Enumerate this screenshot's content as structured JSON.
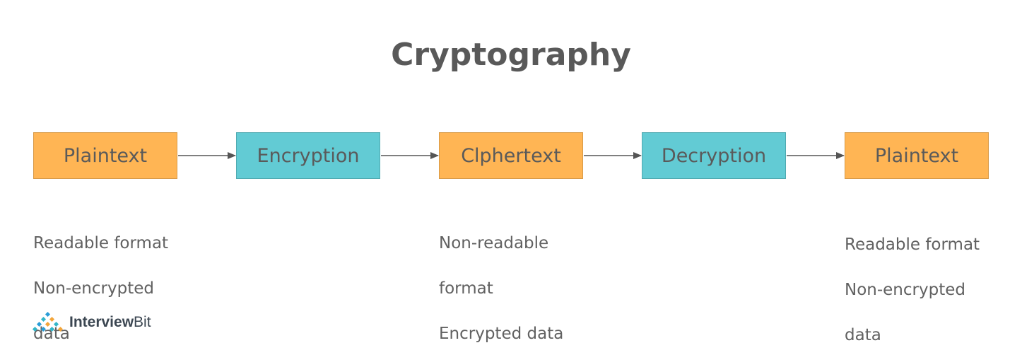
{
  "title": "Cryptography",
  "steps": [
    {
      "label": "Plaintext",
      "kind": "data",
      "color": "#ffb554"
    },
    {
      "label": "Encryption",
      "kind": "process",
      "color": "#62cbd4"
    },
    {
      "label": "Clphertext",
      "kind": "data",
      "color": "#ffb554"
    },
    {
      "label": "Decryption",
      "kind": "process",
      "color": "#62cbd4"
    },
    {
      "label": "Plaintext",
      "kind": "data",
      "color": "#ffb554"
    }
  ],
  "descriptions": {
    "plaintext_in": [
      "Readable format",
      "Non-encrypted",
      "data"
    ],
    "ciphertext": [
      "Non-readable",
      "format",
      "Encrypted data"
    ],
    "plaintext_out": [
      "Readable format",
      "Non-encrypted",
      "data"
    ]
  },
  "logo": {
    "brand": "Interview",
    "brand_suffix": "Bit",
    "icon": "interviewbit-diamond-dots-icon"
  }
}
